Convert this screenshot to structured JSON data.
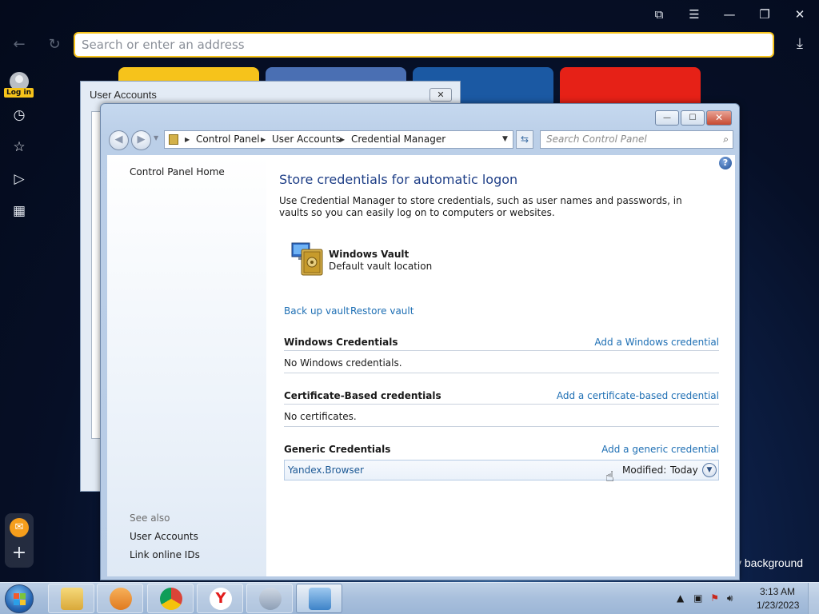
{
  "browser": {
    "address_placeholder": "Search or enter an address",
    "login_label": "Log in",
    "background_label": "v background",
    "tiles": [
      {
        "color": "#f6c31b"
      },
      {
        "color": "#4a6fb3"
      },
      {
        "color": "#1b59a3"
      },
      {
        "color": "#e62117"
      }
    ]
  },
  "user_accounts_window": {
    "title": "User Accounts",
    "close_glyph": "✕"
  },
  "credential_manager": {
    "breadcrumb": [
      "Control Panel",
      "User Accounts",
      "Credential Manager"
    ],
    "search_placeholder": "Search Control Panel",
    "left_pane": {
      "home_link": "Control Panel Home",
      "see_also_label": "See also",
      "see_also_links": [
        "User Accounts",
        "Link online IDs"
      ]
    },
    "title": "Store credentials for automatic logon",
    "description": "Use Credential Manager to store credentials, such as user names and passwords, in vaults so you can easily log on to computers or websites.",
    "vault": {
      "name": "Windows Vault",
      "subtitle": "Default vault location"
    },
    "vault_actions": {
      "backup": "Back up vault",
      "restore": "Restore vault"
    },
    "sections": {
      "windows": {
        "heading": "Windows Credentials",
        "add_link": "Add a Windows credential",
        "empty_text": "No Windows credentials."
      },
      "certificate": {
        "heading": "Certificate-Based credentials",
        "add_link": "Add a certificate-based credential",
        "empty_text": "No certificates."
      },
      "generic": {
        "heading": "Generic Credentials",
        "add_link": "Add a generic credential",
        "items": [
          {
            "name": "Yandex.Browser",
            "modified_label": "Modified:",
            "modified_value": "Today"
          }
        ]
      }
    }
  },
  "taskbar": {
    "clock_time": "3:13 AM",
    "clock_date": "1/23/2023"
  }
}
